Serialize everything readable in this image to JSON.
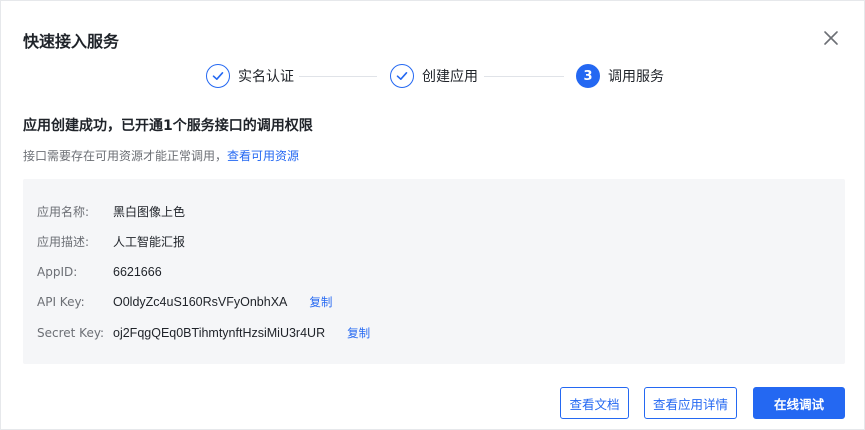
{
  "dialog": {
    "title": "快速接入服务"
  },
  "steps": [
    {
      "label": "实名认证",
      "state": "done"
    },
    {
      "label": "创建应用",
      "state": "done"
    },
    {
      "number": "3",
      "label": "调用服务",
      "state": "active"
    }
  ],
  "message": {
    "headline": "应用创建成功，已开通1个服务接口的调用权限",
    "subline": "接口需要存在可用资源才能正常调用，",
    "link": "查看可用资源"
  },
  "app_info": {
    "name_label": "应用名称:",
    "name_value": "黑白图像上色",
    "desc_label": "应用描述:",
    "desc_value": "人工智能汇报",
    "appid_label": "AppID:",
    "appid_value": "6621666",
    "apikey_label": "API Key:",
    "apikey_value": "O0ldyZc4uS160RsVFyOnbhXA",
    "secret_label": "Secret Key:",
    "secret_value": "oj2FqgQEq0BTihmtynftHzsiMiU3r4UR",
    "copy_label": "复制"
  },
  "buttons": {
    "docs": "查看文档",
    "details": "查看应用详情",
    "debug": "在线调试"
  },
  "colors": {
    "primary": "#2468f2",
    "panel_bg": "#f5f6f8"
  }
}
